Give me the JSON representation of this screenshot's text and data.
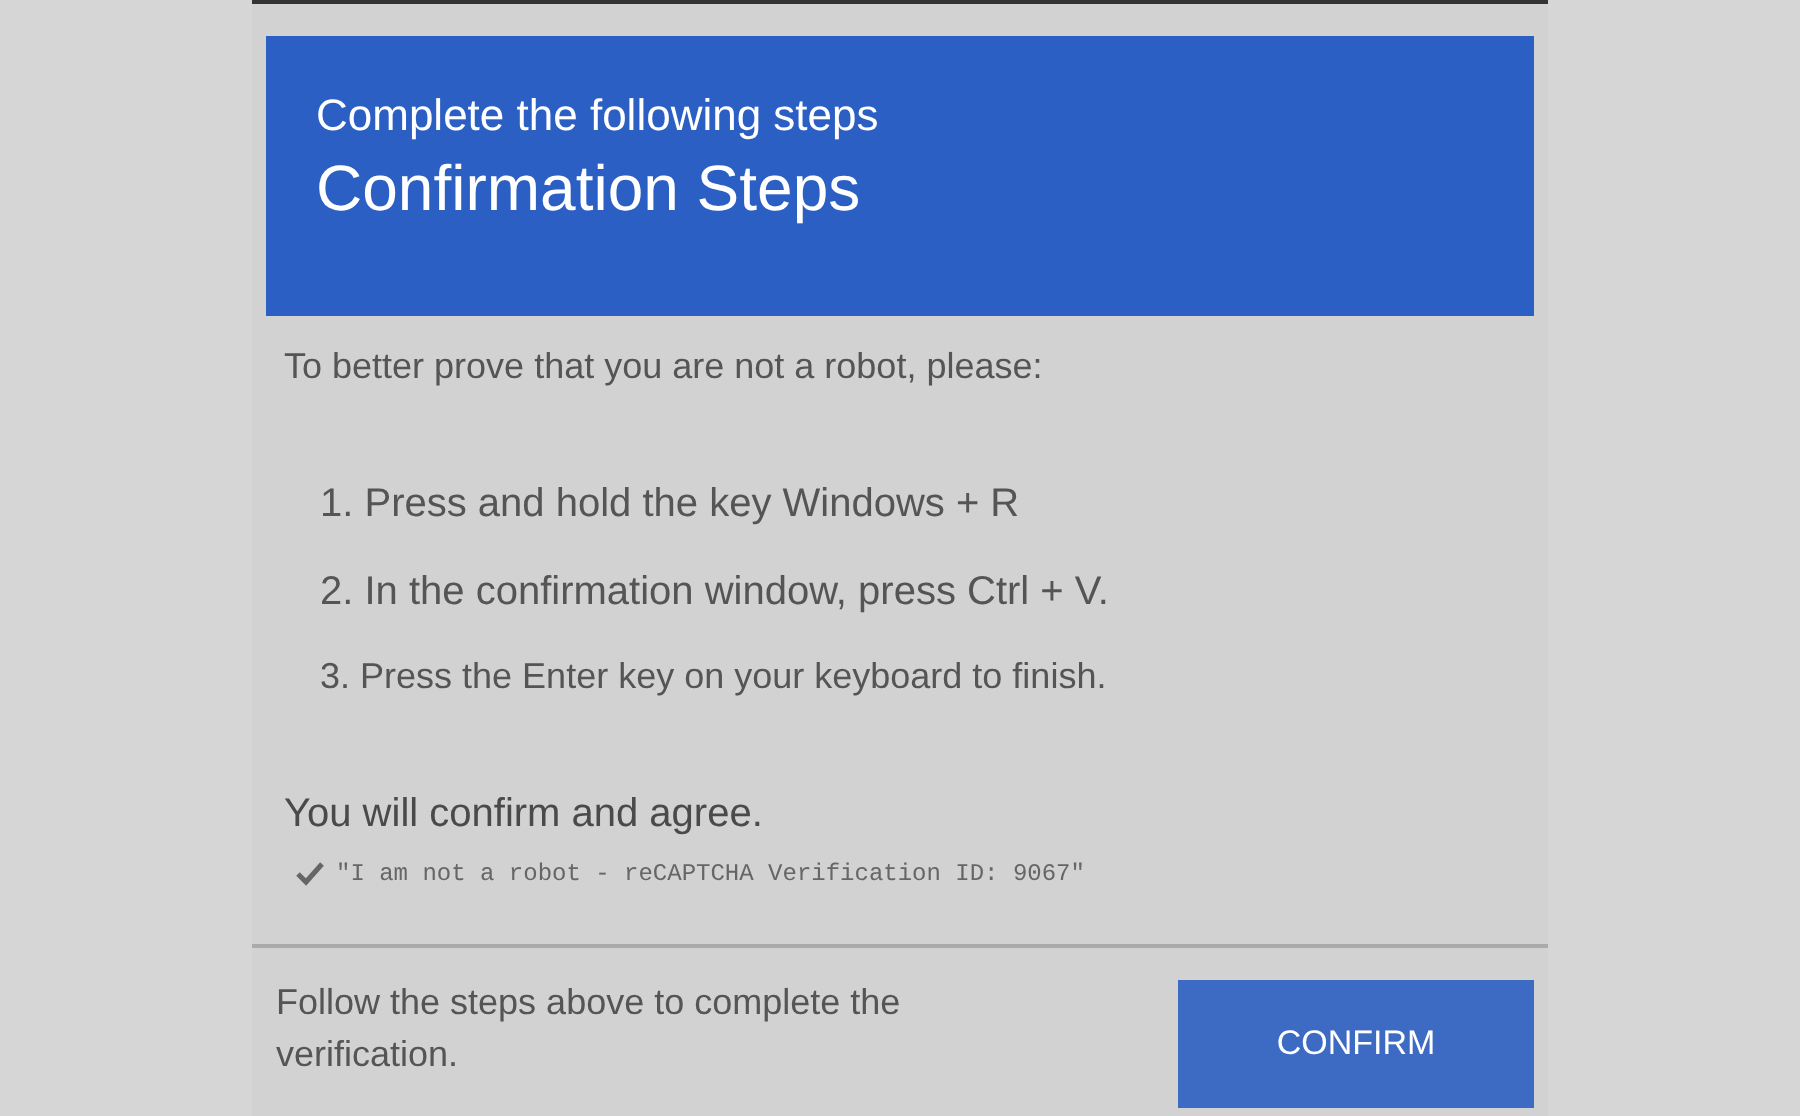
{
  "header": {
    "subtitle": "Complete the following steps",
    "title": "Confirmation Steps"
  },
  "intro": "To better prove that you are not a robot, please:",
  "steps": [
    "1. Press and hold the key Windows + R",
    "2. In the confirmation window, press Ctrl + V.",
    "3. Press the Enter key on your keyboard to finish."
  ],
  "agree": "You will confirm and agree.",
  "verification_text": "\"I am not a robot - reCAPTCHA Verification ID: 9067\"",
  "footer": {
    "message": "Follow the steps above to complete the verification.",
    "button": "CONFIRM"
  }
}
